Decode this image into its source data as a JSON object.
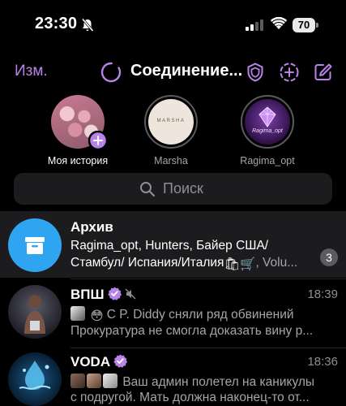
{
  "status_bar": {
    "time": "23:30",
    "battery": "70"
  },
  "header": {
    "edit_label": "Изм.",
    "title": "Соединение..."
  },
  "stories": [
    {
      "label": "Моя история"
    },
    {
      "label": "Marsha",
      "logo_text": "MARSHA"
    },
    {
      "label": "Ragima_opt",
      "logo_text": "Ragima_opt"
    }
  ],
  "search": {
    "placeholder": "Поиск"
  },
  "chats": [
    {
      "title": "Архив",
      "line1": "Ragima_opt, Hunters, Байер США/",
      "line2_text": "Стамбул/ Испания/Италия",
      "line2_rest": ", Volu...",
      "badge": "3"
    },
    {
      "title": "ВПШ",
      "time": "18:39",
      "line1": "С P. Diddy сняли ряд обвинений",
      "line2": "Прокуратура не смогла доказать вину р..."
    },
    {
      "title": "VODA",
      "time": "18:36",
      "line1": "Ваш админ полетел на каникулы",
      "line2": "с подругой. Мать должна наконец-то от..."
    }
  ],
  "colors": {
    "accent": "#b884ea",
    "background": "#000000",
    "secondary_text": "#8e8e93",
    "archive_blue": "#2fa5f2"
  }
}
